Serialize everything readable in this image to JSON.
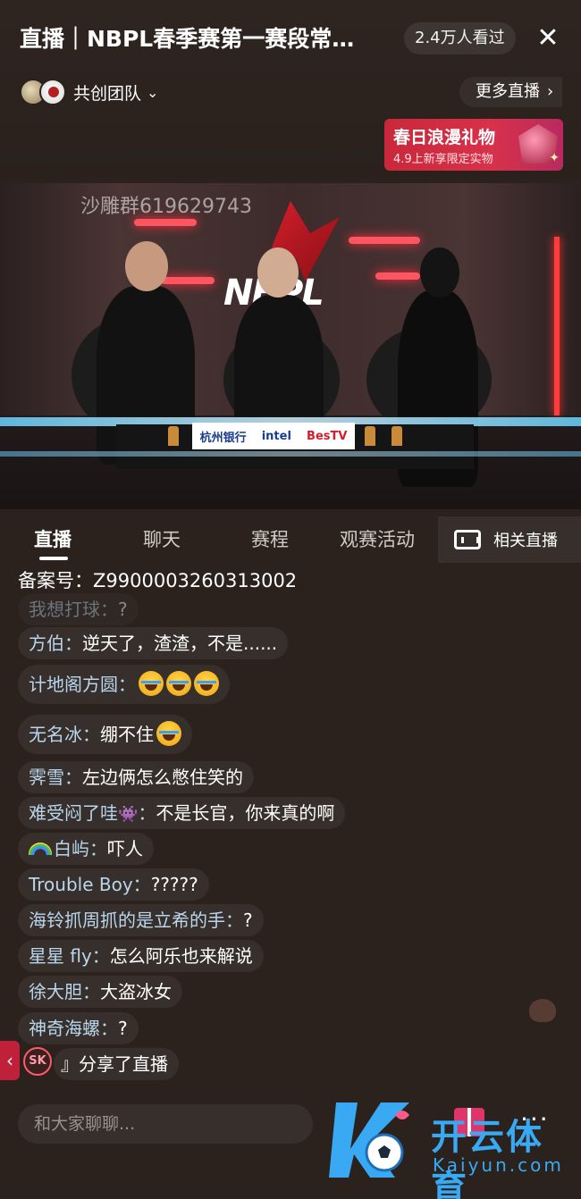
{
  "header": {
    "title": "直播｜NBPL春季赛第一赛段常…",
    "viewers": "2.4万人看过",
    "close_glyph": "✕",
    "team_name": "共创团队",
    "more_live": "更多直播",
    "more_live_arrow": "›",
    "gift_banner": {
      "title": "春日浪漫礼物",
      "subtitle": "4.9上新享限定实物"
    }
  },
  "video": {
    "watermark": "沙雕群619629743",
    "stage_logo": "NBPL",
    "sponsors": [
      "杭州银行",
      "intel",
      "BesTV"
    ]
  },
  "tabs": [
    {
      "label": "直播",
      "active": true
    },
    {
      "label": "聊天",
      "active": false
    },
    {
      "label": "赛程",
      "active": false
    },
    {
      "label": "观赛活动",
      "active": false
    }
  ],
  "related_live": "相关直播",
  "filing": "备案号：Z9900003260313002",
  "chat": [
    {
      "name": "我想打球：",
      "text": "?",
      "faded": true
    },
    {
      "name": "方伯：",
      "text": "逆天了，渣渣，不是......"
    },
    {
      "name": "计地阁方圆：",
      "text": "",
      "emoji_count": 3
    },
    {
      "name": "无名冰：",
      "text": "绷不住",
      "emoji_count": 1
    },
    {
      "name": "霁雪：",
      "text": "左边俩怎么憋住笑的"
    },
    {
      "name": "难受闷了哇",
      "icon": "👾",
      "name_suffix": "：",
      "text": "不是长官，你来真的啊"
    },
    {
      "name": "白屿：",
      "text": "吓人",
      "rainbow": true
    },
    {
      "name": "Trouble Boy：",
      "text": "?????"
    },
    {
      "name": "海铃抓周抓的是立希的手：",
      "text": "?"
    },
    {
      "name": "星星 fly：",
      "text": "怎么阿乐也来解说"
    },
    {
      "name": "徐大胆：",
      "text": "大盗冰女"
    },
    {
      "name": "神奇海螺：",
      "text": "?"
    }
  ],
  "share": {
    "avatar_text": "SK",
    "text": "』分享了直播",
    "left_arrow": "‹"
  },
  "input": {
    "placeholder": "和大家聊聊..."
  },
  "more_glyph": "···",
  "brand": {
    "cn": "开云体育",
    "en": "Kaiyun.com"
  },
  "colors": {
    "background": "#2b221e",
    "chat_name": "#b9d6ec",
    "gift_banner": "#d8314a",
    "brand_blue": "#38a9f2"
  }
}
